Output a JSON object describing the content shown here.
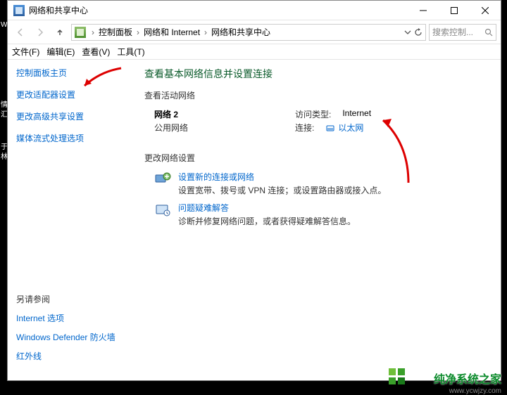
{
  "titlebar": {
    "title": "网络和共享中心"
  },
  "breadcrumb": {
    "items": [
      "控制面板",
      "网络和 Internet",
      "网络和共享中心"
    ]
  },
  "search": {
    "placeholder": "搜索控制..."
  },
  "menubar": {
    "items": [
      "文件(F)",
      "编辑(E)",
      "查看(V)",
      "工具(T)"
    ]
  },
  "sidebar": {
    "home": "控制面板主页",
    "links": [
      "更改适配器设置",
      "更改高级共享设置",
      "媒体流式处理选项"
    ],
    "see_also_header": "另请参阅",
    "see_also": [
      "Internet 选项",
      "Windows Defender 防火墙",
      "红外线"
    ]
  },
  "main": {
    "heading": "查看基本网络信息并设置连接",
    "active_section": "查看活动网络",
    "network": {
      "name": "网络 2",
      "type": "公用网络",
      "access_label": "访问类型:",
      "access_value": "Internet",
      "conn_label": "连接:",
      "conn_value": "以太网"
    },
    "change_section": "更改网络设置",
    "task_new": {
      "title": "设置新的连接或网络",
      "desc": "设置宽带、拨号或 VPN 连接；或设置路由器或接入点。"
    },
    "task_trouble": {
      "title": "问题疑难解答",
      "desc": "诊断并修复网络问题，或者获得疑难解答信息。"
    }
  },
  "watermark": {
    "text": "纯净系统之家",
    "url": "www.ycwjzy.com"
  }
}
